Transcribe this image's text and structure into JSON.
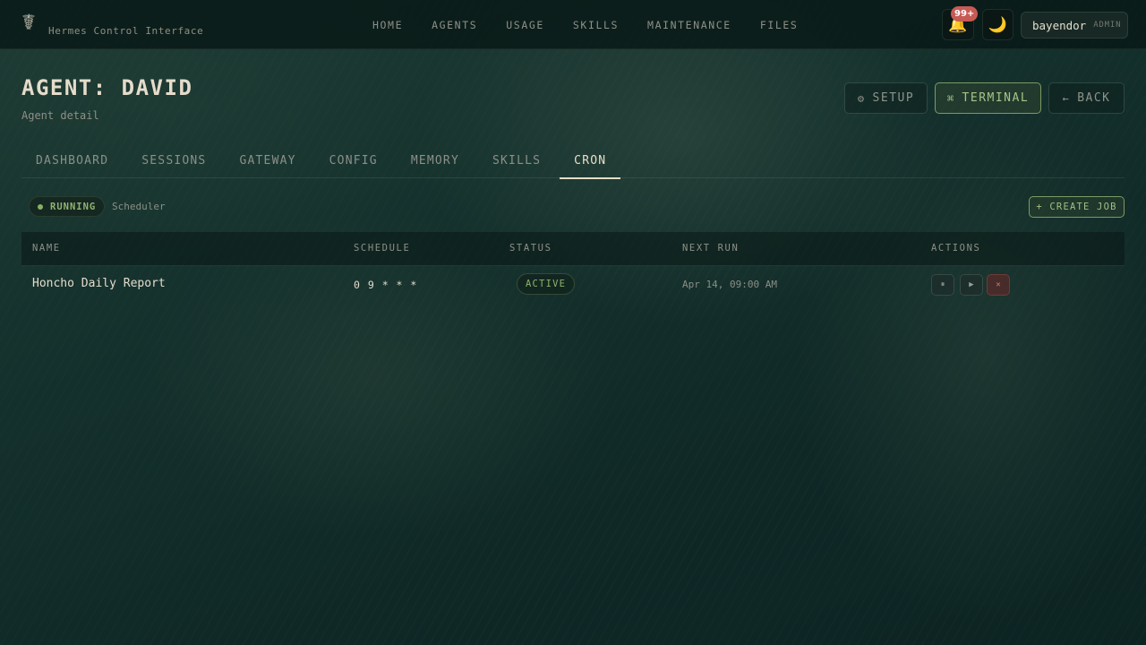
{
  "brand": {
    "subtitle": "Hermes Control Interface",
    "logo_icon": "☤"
  },
  "nav": [
    "HOME",
    "AGENTS",
    "USAGE",
    "SKILLS",
    "MAINTENANCE",
    "FILES"
  ],
  "notifications": {
    "count": "99+",
    "icon": "🔔"
  },
  "theme_toggle": {
    "icon": "🌙"
  },
  "user": {
    "name": "bayendor",
    "role": "ADMIN"
  },
  "page": {
    "title": "AGENT: DAVID",
    "subtitle": "Agent detail"
  },
  "header_buttons": {
    "setup": {
      "icon": "⚙",
      "label": "SETUP"
    },
    "terminal": {
      "icon": "⌘",
      "label": "TERMINAL"
    },
    "back": {
      "icon": "←",
      "label": "BACK"
    }
  },
  "tabs": [
    "DASHBOARD",
    "SESSIONS",
    "GATEWAY",
    "CONFIG",
    "MEMORY",
    "SKILLS",
    "CRON"
  ],
  "active_tab": "CRON",
  "scheduler": {
    "status": "RUNNING",
    "label": "Scheduler"
  },
  "create_job": {
    "label": "+ CREATE JOB"
  },
  "table": {
    "headers": {
      "name": "NAME",
      "schedule": "SCHEDULE",
      "status": "STATUS",
      "next_run": "NEXT RUN",
      "actions": "ACTIONS"
    },
    "rows": [
      {
        "name": "Honcho Daily Report",
        "schedule": "0 9 * * *",
        "status": "ACTIVE",
        "next_run": "Apr 14, 09:00 AM",
        "actions": {
          "pause": "⏸",
          "run": "▶",
          "delete": "✕"
        }
      }
    ]
  },
  "colors": {
    "accent": "#a7c387",
    "danger": "#c65b55",
    "background": "#0f2422"
  }
}
